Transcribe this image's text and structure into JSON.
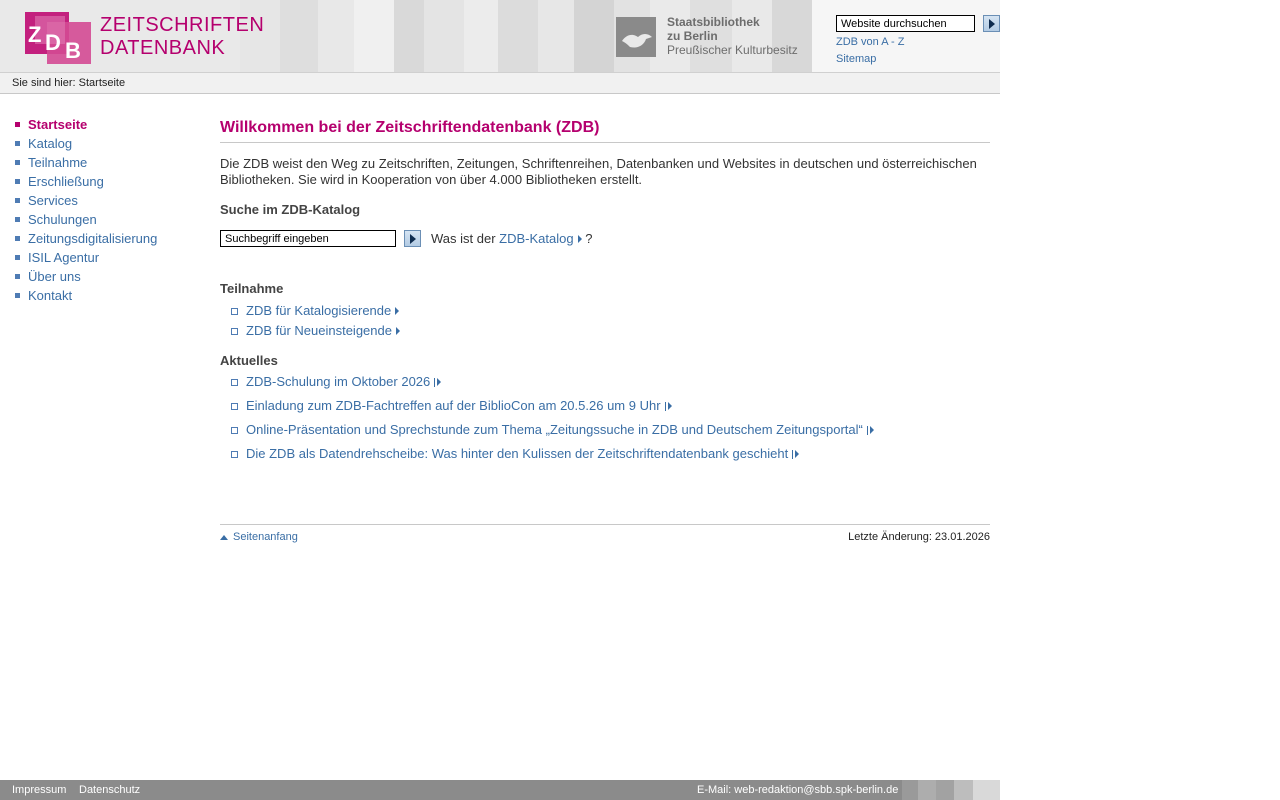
{
  "header": {
    "logo_lines": [
      "ZEITSCHRIFTEN",
      "DATENBANK"
    ],
    "partner_lines": [
      "Staatsbibliothek",
      "zu Berlin",
      "Preußischer Kulturbesitz"
    ],
    "search_value": "Website durchsuchen",
    "links": {
      "a_z": "ZDB von A - Z",
      "sitemap": "Sitemap"
    }
  },
  "breadcrumb": "Sie sind hier: Startseite",
  "nav": [
    {
      "label": "Startseite",
      "active": true
    },
    {
      "label": "Katalog"
    },
    {
      "label": "Teilnahme"
    },
    {
      "label": "Erschließung"
    },
    {
      "label": "Services"
    },
    {
      "label": "Schulungen"
    },
    {
      "label": "Zeitungsdigitalisierung"
    },
    {
      "label": "ISIL Agentur"
    },
    {
      "label": "Über uns"
    },
    {
      "label": "Kontakt"
    }
  ],
  "main": {
    "title": "Willkommen bei der Zeitschriftendatenbank (ZDB)",
    "intro": "Die ZDB weist den Weg zu Zeitschriften, Zeitungen, Schriftenreihen, Datenbanken und Websites in deutschen und österreichischen Bibliotheken. Sie wird in Kooperation von über 4.000 Bibliotheken erstellt.",
    "catalog_search": {
      "heading": "Suche im ZDB-Katalog",
      "input_value": "Suchbegriff eingeben",
      "help_prefix": "Was ist der ",
      "help_link": "ZDB-Katalog",
      "help_suffix": " ?"
    },
    "teilnahme": {
      "heading": "Teilnahme",
      "links": [
        "ZDB für Katalogisierende",
        "ZDB für Neueinsteigende"
      ]
    },
    "aktuelles": {
      "heading": "Aktuelles",
      "links": [
        "ZDB-Schulung im Oktober 2026",
        "Einladung zum ZDB-Fachtreffen auf der BiblioCon am 20.5.26 um 9 Uhr",
        "Online-Präsentation und Sprechstunde zum Thema „Zeitungssuche in ZDB und Deutschem Zeitungsportal“",
        "Die ZDB als Datendrehscheibe: Was hinter den Kulissen der Zeitschriftendatenbank geschieht"
      ]
    }
  },
  "content_footer": {
    "to_top": "Seitenanfang",
    "last_changed": "Letzte Änderung: 23.01.2026"
  },
  "footer": {
    "impressum": "Impressum",
    "datenschutz": "Datenschutz",
    "email": "E-Mail: web-redaktion@sbb.spk-berlin.de"
  },
  "colors": {
    "brand": "#b5006e",
    "link": "#3a6ea5",
    "footer_bg": "#8b8b8b"
  },
  "icons": [
    "zdb-logo-icon",
    "sbb-eagle-icon",
    "search-go-icon",
    "arrow-right-icon",
    "external-link-icon",
    "arrow-up-icon"
  ]
}
